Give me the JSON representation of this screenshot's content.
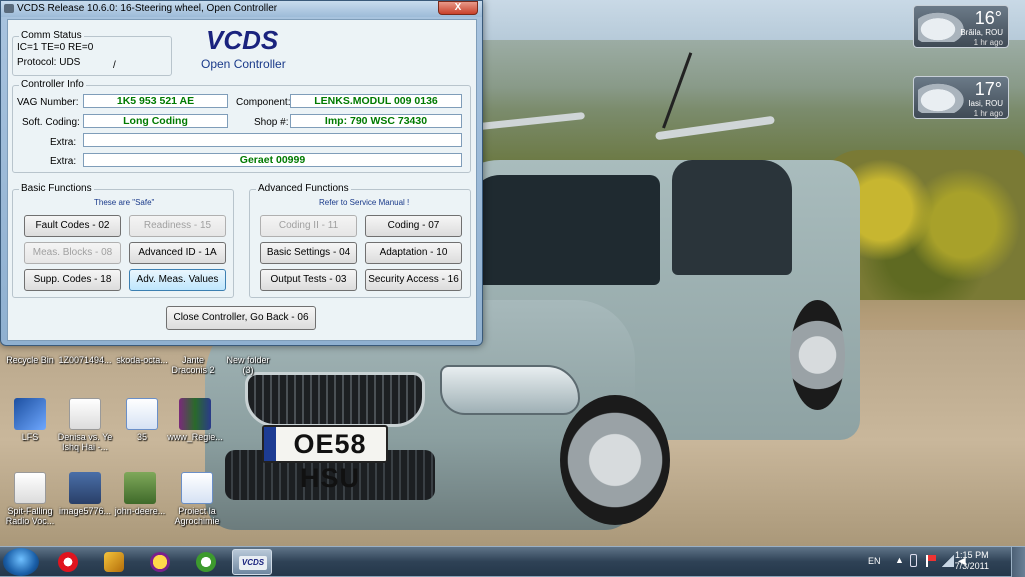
{
  "window": {
    "title": "VCDS Release 10.6.0: 16-Steering wheel,  Open Controller",
    "close_glyph": "X",
    "logo": "VCDS",
    "subtitle": "Open Controller",
    "comm_status": {
      "title": "Comm Status",
      "line1": "IC=1  TE=0   RE=0",
      "protocol": "Protocol: UDS",
      "slash": "/"
    },
    "controller_info": {
      "title": "Controller Info",
      "vag_number_label": "VAG Number:",
      "vag_number": "1K5 953 521 AE",
      "component_label": "Component:",
      "component": "LENKS.MODUL   009 0136",
      "soft_coding_label": "Soft. Coding:",
      "soft_coding": "Long Coding",
      "shop_label": "Shop #:",
      "shop": "Imp: 790     WSC 73430",
      "extra_label1": "Extra:",
      "extra1": "",
      "extra_label2": "Extra:",
      "extra2": "Geraet 00999"
    },
    "basic_functions": {
      "title": "Basic Functions",
      "note": "These are \"Safe\"",
      "fault_codes": "Fault Codes - 02",
      "readiness": "Readiness - 15",
      "meas_blocks": "Meas. Blocks - 08",
      "advanced_id": "Advanced ID - 1A",
      "supp_codes": "Supp. Codes - 18",
      "adv_meas": "Adv. Meas. Values"
    },
    "advanced_functions": {
      "title": "Advanced Functions",
      "note": "Refer to Service Manual !",
      "coding2": "Coding II - 11",
      "coding": "Coding - 07",
      "basic_settings": "Basic Settings - 04",
      "adaptation": "Adaptation - 10",
      "output_tests": "Output Tests - 03",
      "security_access": "Security Access - 16"
    },
    "close_controller": "Close Controller, Go Back - 06"
  },
  "gadgets": [
    {
      "temp": "16°",
      "city": "Brăila, ROU",
      "ago": "1 hr ago"
    },
    {
      "temp": "17°",
      "city": "Iasi, ROU",
      "ago": "1 hr ago"
    }
  ],
  "desktop_icons": {
    "row1": [
      "Recycle Bin",
      "1Z0071494...",
      "skoda-octa...",
      "Jante Draconis 2",
      "New folder (3)"
    ],
    "lfs": "LFS",
    "denisa": "Denisa vs. Ye Ishq Hai -...",
    "n35": "35",
    "www": "www_Regie...",
    "spit": "Spit-Falling Radio Voc...",
    "image": "image5776...",
    "john": "john-deere...",
    "proiect": "Proiect la Agrochimie"
  },
  "plate": "OE58 HSU",
  "taskbar": {
    "lang": "EN",
    "time": "1:15 PM",
    "date": "7/3/2011",
    "apps": [
      "opera-icon",
      "winamp-icon",
      "yahoo-messenger-icon",
      "utorrent-icon",
      "vcds-icon"
    ],
    "vcds_label": "VCDS"
  },
  "colors": {
    "field_text": "#007a00",
    "logo": "#1a237e",
    "taskbar": "#2f4256"
  }
}
